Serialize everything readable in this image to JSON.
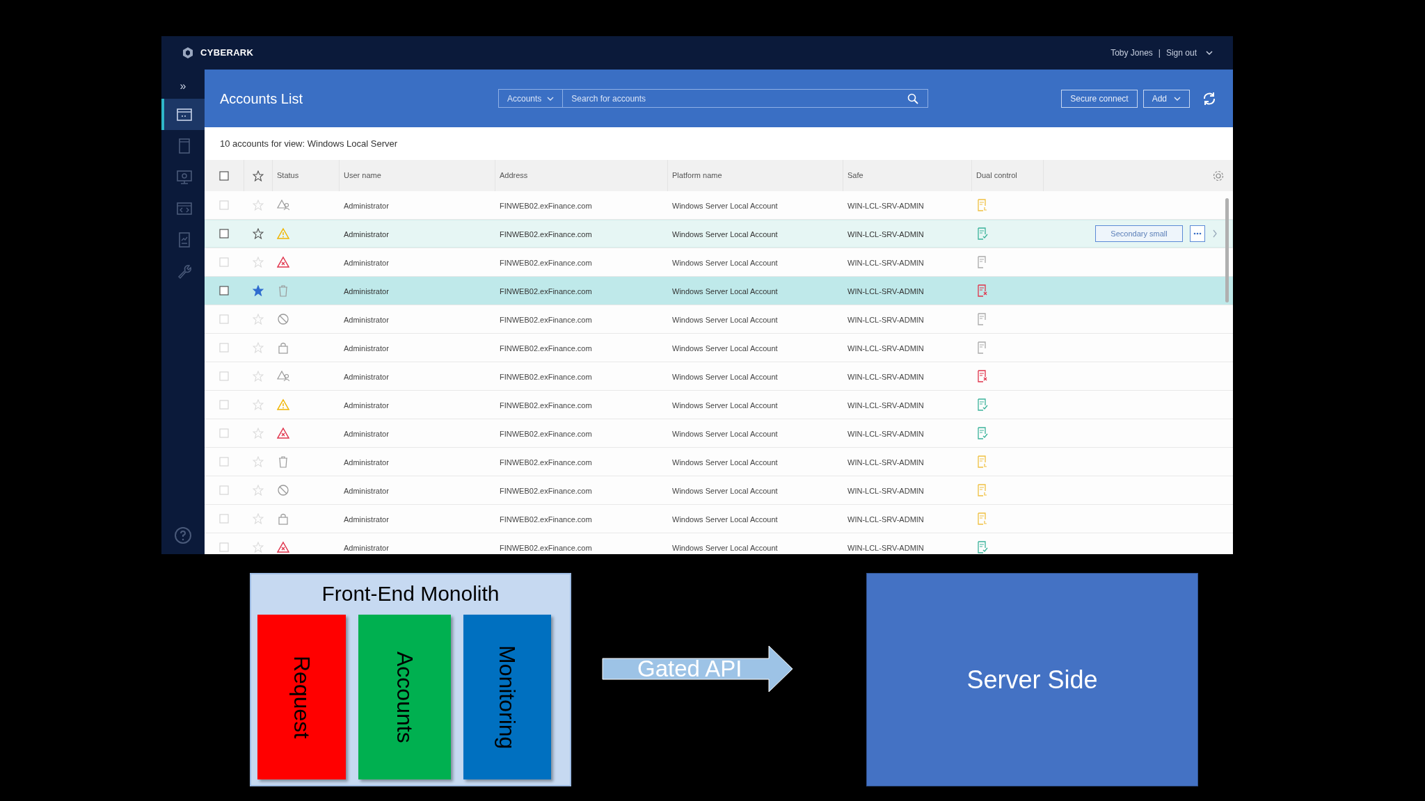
{
  "app": {
    "logo": "CYBERARK",
    "user": "Toby Jones",
    "separator": "|",
    "sign_out": "Sign out"
  },
  "sidebar": {
    "expand": "»",
    "items": [
      {
        "kind": "window",
        "selected": true
      },
      {
        "kind": "document",
        "selected": false
      },
      {
        "kind": "monitor",
        "selected": false
      },
      {
        "kind": "code",
        "selected": false
      },
      {
        "kind": "report",
        "selected": false
      },
      {
        "kind": "wrench",
        "selected": false
      }
    ]
  },
  "header": {
    "title": "Accounts List",
    "scope": "Accounts",
    "search": {
      "placeholder": "Search for accounts"
    },
    "buttons": [
      "Secure connect",
      "Add"
    ]
  },
  "summary": "10 accounts for view: Windows Local Server",
  "table": {
    "select_all_checked": false,
    "columns": [
      "Status",
      "User name",
      "Address",
      "Platform name",
      "Safe",
      "Dual control"
    ],
    "rows": [
      {
        "checked": false,
        "status": {
          "kind": "user-warning"
        },
        "user": "Administrator",
        "address": "FINWEB02.exFinance.com",
        "platform": "Windows Server Local Account",
        "safe": "WIN-LCL-SRV-ADMIN",
        "dual": {
          "kind": "pending"
        },
        "favorite": false,
        "hovered": false,
        "selected": false
      },
      {
        "checked": false,
        "status": {
          "kind": "warning"
        },
        "user": "Administrator",
        "address": "FINWEB02.exFinance.com",
        "platform": "Windows Server Local Account",
        "safe": "WIN-LCL-SRV-ADMIN",
        "dual": {
          "kind": "approved"
        },
        "favorite": false,
        "hovered": true,
        "selected": false,
        "action": "Secondary small"
      },
      {
        "checked": false,
        "status": {
          "kind": "error"
        },
        "user": "Administrator",
        "address": "FINWEB02.exFinance.com",
        "platform": "Windows Server Local Account",
        "safe": "WIN-LCL-SRV-ADMIN",
        "dual": {
          "kind": "none"
        },
        "favorite": false,
        "hovered": false,
        "selected": false
      },
      {
        "checked": false,
        "status": {
          "kind": "deleted"
        },
        "user": "Administrator",
        "address": "FINWEB02.exFinance.com",
        "platform": "Windows Server Local Account",
        "safe": "WIN-LCL-SRV-ADMIN",
        "dual": {
          "kind": "rejected"
        },
        "favorite": true,
        "hovered": false,
        "selected": true
      },
      {
        "checked": false,
        "status": {
          "kind": "blocked"
        },
        "user": "Administrator",
        "address": "FINWEB02.exFinance.com",
        "platform": "Windows Server Local Account",
        "safe": "WIN-LCL-SRV-ADMIN",
        "dual": {
          "kind": "none"
        },
        "favorite": false,
        "hovered": false,
        "selected": false
      },
      {
        "checked": false,
        "status": {
          "kind": "locked"
        },
        "user": "Administrator",
        "address": "FINWEB02.exFinance.com",
        "platform": "Windows Server Local Account",
        "safe": "WIN-LCL-SRV-ADMIN",
        "dual": {
          "kind": "none"
        },
        "favorite": false,
        "hovered": false,
        "selected": false
      },
      {
        "checked": false,
        "status": {
          "kind": "user-warning"
        },
        "user": "Administrator",
        "address": "FINWEB02.exFinance.com",
        "platform": "Windows Server Local Account",
        "safe": "WIN-LCL-SRV-ADMIN",
        "dual": {
          "kind": "rejected"
        },
        "favorite": false,
        "hovered": false,
        "selected": false
      },
      {
        "checked": false,
        "status": {
          "kind": "warning"
        },
        "user": "Administrator",
        "address": "FINWEB02.exFinance.com",
        "platform": "Windows Server Local Account",
        "safe": "WIN-LCL-SRV-ADMIN",
        "dual": {
          "kind": "approved"
        },
        "favorite": false,
        "hovered": false,
        "selected": false
      },
      {
        "checked": false,
        "status": {
          "kind": "error"
        },
        "user": "Administrator",
        "address": "FINWEB02.exFinance.com",
        "platform": "Windows Server Local Account",
        "safe": "WIN-LCL-SRV-ADMIN",
        "dual": {
          "kind": "approved"
        },
        "favorite": false,
        "hovered": false,
        "selected": false
      },
      {
        "checked": false,
        "status": {
          "kind": "deleted"
        },
        "user": "Administrator",
        "address": "FINWEB02.exFinance.com",
        "platform": "Windows Server Local Account",
        "safe": "WIN-LCL-SRV-ADMIN",
        "dual": {
          "kind": "pending"
        },
        "favorite": false,
        "hovered": false,
        "selected": false
      },
      {
        "checked": false,
        "status": {
          "kind": "blocked"
        },
        "user": "Administrator",
        "address": "FINWEB02.exFinance.com",
        "platform": "Windows Server Local Account",
        "safe": "WIN-LCL-SRV-ADMIN",
        "dual": {
          "kind": "pending"
        },
        "favorite": false,
        "hovered": false,
        "selected": false
      },
      {
        "checked": false,
        "status": {
          "kind": "locked"
        },
        "user": "Administrator",
        "address": "FINWEB02.exFinance.com",
        "platform": "Windows Server Local Account",
        "safe": "WIN-LCL-SRV-ADMIN",
        "dual": {
          "kind": "pending"
        },
        "favorite": false,
        "hovered": false,
        "selected": false
      },
      {
        "checked": false,
        "status": {
          "kind": "error"
        },
        "user": "Administrator",
        "address": "FINWEB02.exFinance.com",
        "platform": "Windows Server Local Account",
        "safe": "WIN-LCL-SRV-ADMIN",
        "dual": {
          "kind": "approved"
        },
        "favorite": false,
        "hovered": false,
        "selected": false
      }
    ]
  },
  "diagram": {
    "monolith": {
      "title": "Front-End Monolith",
      "modules": [
        {
          "label": "Request",
          "color": "#ff0000"
        },
        {
          "label": "Accounts",
          "color": "#00b050"
        },
        {
          "label": "Monitoring",
          "color": "#0070c0"
        }
      ]
    },
    "arrow": "Gated API",
    "server": "Server Side"
  }
}
